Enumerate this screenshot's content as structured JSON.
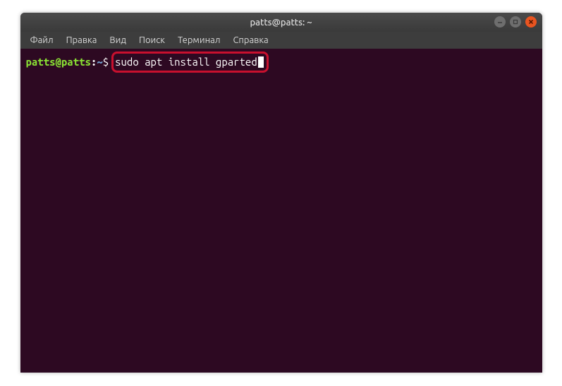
{
  "window": {
    "title": "patts@patts: ~"
  },
  "menubar": {
    "file": "Файл",
    "edit": "Правка",
    "view": "Вид",
    "search": "Поиск",
    "terminal": "Терминал",
    "help": "Справка"
  },
  "terminal": {
    "prompt_user": "patts@patts",
    "prompt_colon": ":",
    "prompt_path": "~",
    "prompt_symbol": "$",
    "command": "sudo apt install gparted"
  }
}
